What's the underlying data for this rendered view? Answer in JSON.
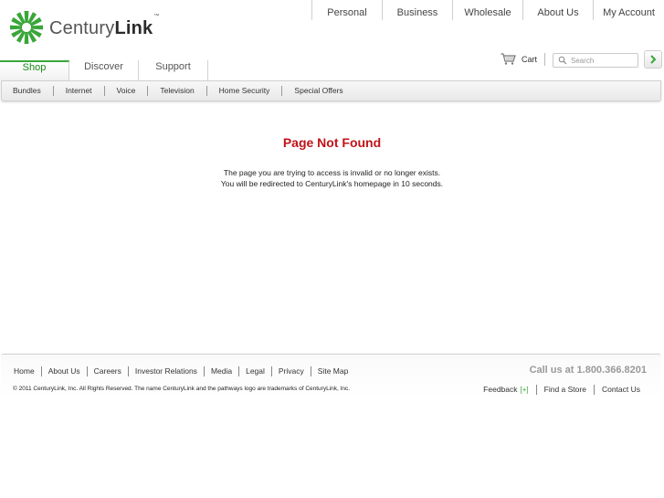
{
  "brand": {
    "name_light": "Century",
    "name_bold": "Link",
    "trademark": "™",
    "colors": {
      "green": "#3aa63a",
      "dark_green": "#1a8a1a",
      "red": "#c0141a"
    }
  },
  "top_nav": [
    "Personal",
    "Business",
    "Wholesale",
    "About Us",
    "My Account"
  ],
  "tabs": [
    {
      "label": "Shop",
      "active": true
    },
    {
      "label": "Discover",
      "active": false
    },
    {
      "label": "Support",
      "active": false
    }
  ],
  "cart": {
    "label": "Cart",
    "icon": "cart-icon"
  },
  "search": {
    "placeholder": "Search",
    "icon": "search-icon",
    "go_icon": "chevron-right-icon"
  },
  "subnav": [
    "Bundles",
    "Internet",
    "Voice",
    "Television",
    "Home Security",
    "Special Offers"
  ],
  "main": {
    "title": "Page Not Found",
    "line1": "The page you are trying to access is invalid or no longer exists.",
    "line2": "You will be redirected to CenturyLink's homepage in 10 seconds."
  },
  "footer": {
    "links": [
      "Home",
      "About Us",
      "Careers",
      "Investor Relations",
      "Media",
      "Legal",
      "Privacy",
      "Site Map"
    ],
    "call": "Call us at 1.800.366.8201",
    "copyright": "© 2011 CenturyLink, Inc. All Rights Reserved. The name CenturyLink and the pathways logo are trademarks of CenturyLink, Inc.",
    "feedback": "Feedback",
    "feedback_plus": "[+]",
    "find_store": "Find a Store",
    "contact": "Contact Us"
  }
}
